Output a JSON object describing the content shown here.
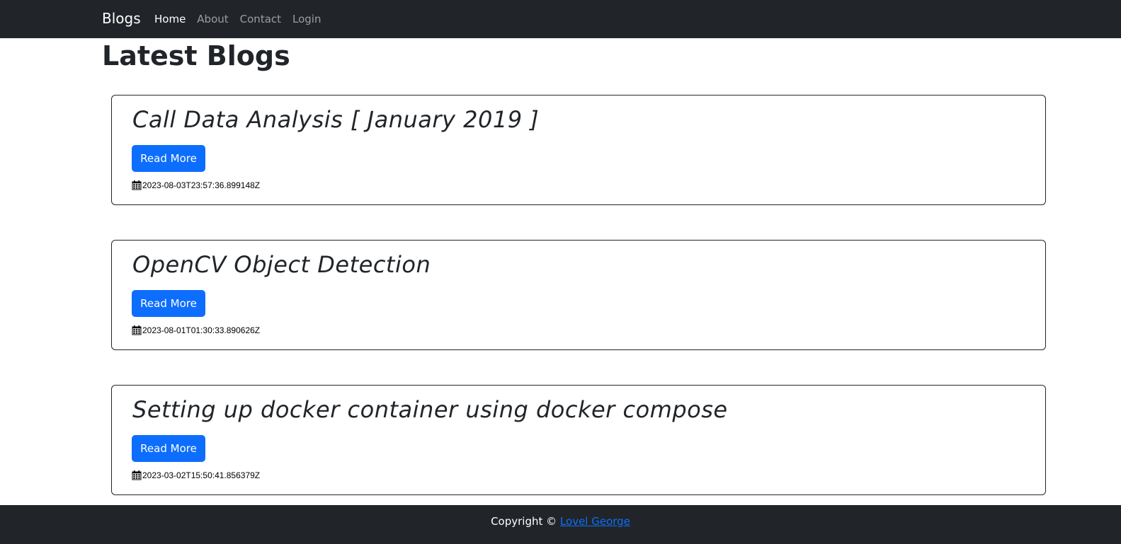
{
  "nav": {
    "brand": "Blogs",
    "links": [
      {
        "label": "Home",
        "active": true
      },
      {
        "label": "About",
        "active": false
      },
      {
        "label": "Contact",
        "active": false
      },
      {
        "label": "Login",
        "active": false
      }
    ]
  },
  "page_title": "Latest Blogs",
  "posts": [
    {
      "title": "Call Data Analysis [ January 2019 ]",
      "button": "Read More",
      "date": "2023-08-03T23:57:36.899148Z"
    },
    {
      "title": "OpenCV Object Detection",
      "button": "Read More",
      "date": "2023-08-01T01:30:33.890626Z"
    },
    {
      "title": "Setting up docker container using docker compose",
      "button": "Read More",
      "date": "2023-03-02T15:50:41.856379Z"
    }
  ],
  "footer": {
    "prefix": "Copyright © ",
    "author": "Lovel George"
  },
  "colors": {
    "navbar_bg": "#212529",
    "primary": "#0d6efd",
    "footer_bg": "#212529"
  },
  "icons": {
    "date": "calendar-icon"
  }
}
